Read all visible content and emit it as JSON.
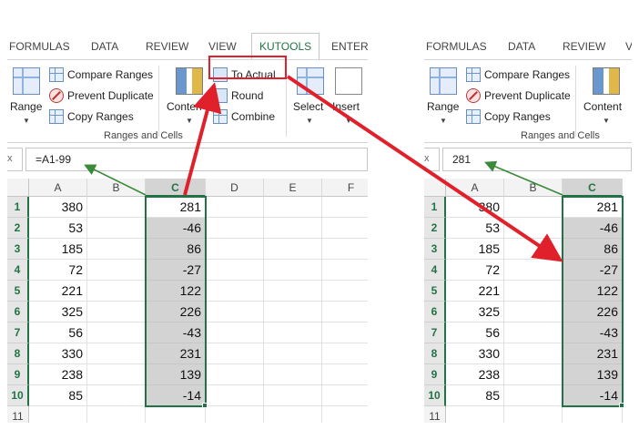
{
  "left": {
    "tabs": [
      "FORMULAS",
      "DATA",
      "REVIEW",
      "VIEW",
      "KUTOOLS",
      "ENTERI"
    ],
    "active_tab": "KUTOOLS",
    "ribbon": {
      "range_label": "Range",
      "compare_ranges": "Compare Ranges",
      "prevent_duplicate": "Prevent Duplicate",
      "copy_ranges": "Copy Ranges",
      "content_label": "Conten",
      "to_actual": "To Actual",
      "round": "Round",
      "combine": "Combine",
      "select_label": "Select",
      "insert_label": "Insert",
      "group_label": "Ranges and Cells"
    },
    "formula_bar": {
      "namebox_tail": "x",
      "value": "=A1-99"
    },
    "columns": [
      "A",
      "B",
      "C",
      "D",
      "E",
      "F"
    ],
    "rows": [
      "1",
      "2",
      "3",
      "4",
      "5",
      "6",
      "7",
      "8",
      "9",
      "10",
      "11"
    ],
    "col_a": [
      "380",
      "53",
      "185",
      "72",
      "221",
      "325",
      "56",
      "330",
      "238",
      "85"
    ],
    "col_c": [
      "281",
      "-46",
      "86",
      "-27",
      "122",
      "226",
      "-43",
      "231",
      "139",
      "-14"
    ]
  },
  "right": {
    "tabs": [
      "FORMULAS",
      "DATA",
      "REVIEW",
      "V"
    ],
    "ribbon": {
      "range_label": "Range",
      "compare_ranges": "Compare Ranges",
      "prevent_duplicate": "Prevent Duplicate",
      "copy_ranges": "Copy Ranges",
      "content_label": "Content",
      "group_label": "Ranges and Cells"
    },
    "formula_bar": {
      "namebox_tail": "x",
      "value": "281"
    },
    "columns": [
      "A",
      "B",
      "C"
    ],
    "rows": [
      "1",
      "2",
      "3",
      "4",
      "5",
      "6",
      "7",
      "8",
      "9",
      "10",
      "11"
    ],
    "col_a": [
      "380",
      "53",
      "185",
      "72",
      "221",
      "325",
      "56",
      "330",
      "238",
      "85"
    ],
    "col_c": [
      "281",
      "-46",
      "86",
      "-27",
      "122",
      "226",
      "-43",
      "231",
      "139",
      "-14"
    ]
  },
  "colors": {
    "excel_green": "#217346",
    "annotation_red": "#e0212b",
    "annotation_green": "#3a8a3a",
    "selection_fill": "#d3d3d3"
  },
  "icons": [
    "compare-icon",
    "prevent-duplicate-icon",
    "copy-ranges-icon",
    "to-actual-icon",
    "round-icon",
    "combine-icon",
    "range-icon",
    "content-icon",
    "select-icon",
    "insert-icon"
  ]
}
